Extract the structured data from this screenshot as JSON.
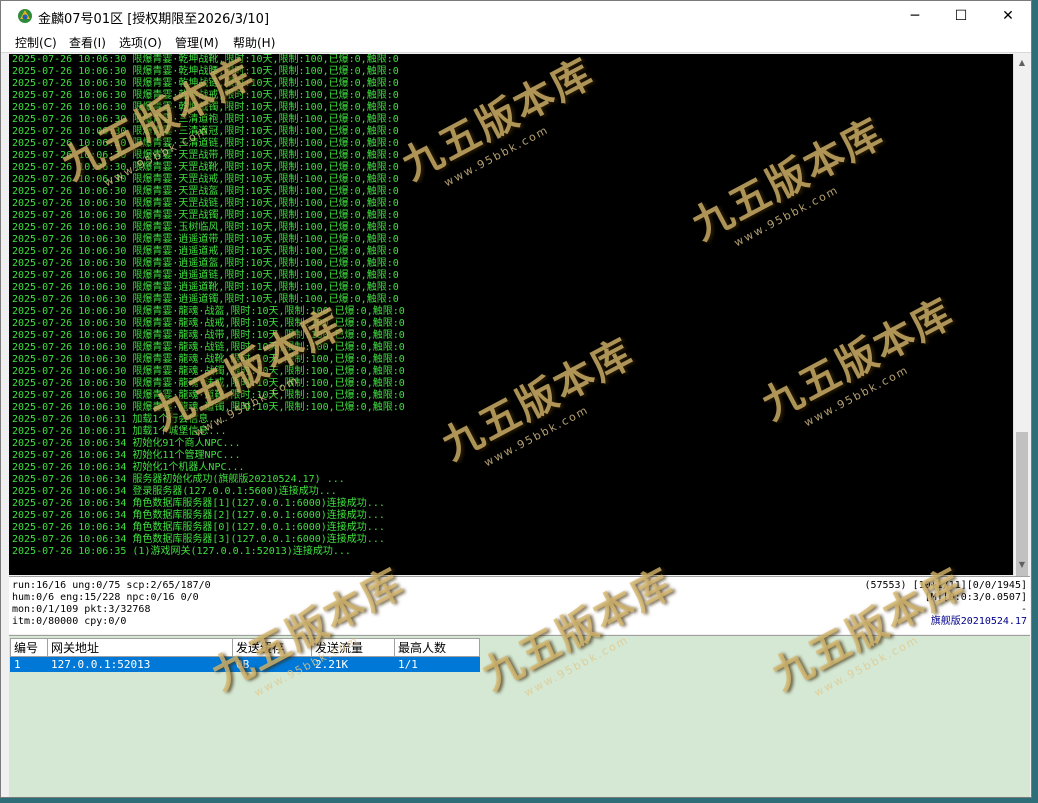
{
  "window": {
    "title": "金麟07号01区 [授权期限至2026/3/10]",
    "controls": {
      "minimize": "─",
      "maximize": "☐",
      "close": "✕"
    }
  },
  "menu": [
    {
      "label": "控制(C)"
    },
    {
      "label": "查看(I)"
    },
    {
      "label": "选项(O)"
    },
    {
      "label": "管理(M)"
    },
    {
      "label": "帮助(H)"
    }
  ],
  "console": {
    "lines": [
      "2025-07-26 10:06:30 限爆青霎·乾坤战靴,限时:10天,限制:100,已爆:0,触限:0",
      "2025-07-26 10:06:30 限爆青霎·乾坤战腰,限时:10天,限制:100,已爆:0,触限:0",
      "2025-07-26 10:06:30 限爆青霎·乾坤战链,限时:10天,限制:100,已爆:0,触限:0",
      "2025-07-26 10:06:30 限爆青霎·乾坤战戒,限时:10天,限制:100,已爆:0,触限:0",
      "2025-07-26 10:06:30 限爆青霎·乾坤战镯,限时:10天,限制:100,已爆:0,触限:0",
      "2025-07-26 10:06:30 限爆青霎·三清道袍,限时:10天,限制:100,已爆:0,触限:0",
      "2025-07-26 10:06:30 限爆青霎·三清道冠,限时:10天,限制:100,已爆:0,触限:0",
      "2025-07-26 10:06:30 限爆青霎·三清道链,限时:10天,限制:100,已爆:0,触限:0",
      "2025-07-26 10:06:30 限爆青霎·天罡战带,限时:10天,限制:100,已爆:0,触限:0",
      "2025-07-26 10:06:30 限爆青霎·天罡战靴,限时:10天,限制:100,已爆:0,触限:0",
      "2025-07-26 10:06:30 限爆青霎·天罡战戒,限时:10天,限制:100,已爆:0,触限:0",
      "2025-07-26 10:06:30 限爆青霎·天罡战盔,限时:10天,限制:100,已爆:0,触限:0",
      "2025-07-26 10:06:30 限爆青霎·天罡战链,限时:10天,限制:100,已爆:0,触限:0",
      "2025-07-26 10:06:30 限爆青霎·天罡战镯,限时:10天,限制:100,已爆:0,触限:0",
      "2025-07-26 10:06:30 限爆青霎·玉树临风,限时:10天,限制:100,已爆:0,触限:0",
      "2025-07-26 10:06:30 限爆青霎·逍遥道带,限时:10天,限制:100,已爆:0,触限:0",
      "2025-07-26 10:06:30 限爆青霎·逍遥道戒,限时:10天,限制:100,已爆:0,触限:0",
      "2025-07-26 10:06:30 限爆青霎·逍遥道盔,限时:10天,限制:100,已爆:0,触限:0",
      "2025-07-26 10:06:30 限爆青霎·逍遥道链,限时:10天,限制:100,已爆:0,触限:0",
      "2025-07-26 10:06:30 限爆青霎·逍遥道靴,限时:10天,限制:100,已爆:0,触限:0",
      "2025-07-26 10:06:30 限爆青霎·逍遥道镯,限时:10天,限制:100,已爆:0,触限:0",
      "2025-07-26 10:06:30 限爆青霎·龍魂·战盔,限时:10天,限制:100,已爆:0,触限:0",
      "2025-07-26 10:06:30 限爆青霎·龍魂·战戒,限时:10天,限制:100,已爆:0,触限:0",
      "2025-07-26 10:06:30 限爆青霎·龍魂·战带,限时:10天,限制:100,已爆:0,触限:0",
      "2025-07-26 10:06:30 限爆青霎·龍魂·战链,限时:10天,限制:100,已爆:0,触限:0",
      "2025-07-26 10:06:30 限爆青霎·龍魂·战靴,限时:10天,限制:100,已爆:0,触限:0",
      "2025-07-26 10:06:30 限爆青霎·龍魂·战镯,限时:10天,限制:100,已爆:0,触限:0",
      "2025-07-26 10:06:30 限爆青霎·龍魂·法戒,限时:10天,限制:100,已爆:0,触限:0",
      "2025-07-26 10:06:30 限爆青霎·龍魂·道靴,限时:10天,限制:100,已爆:0,触限:0",
      "2025-07-26 10:06:30 限爆青霎·龍魂·道镯,限时:10天,限制:100,已爆:0,触限:0",
      "2025-07-26 10:06:31 加载1个行会信息...",
      "2025-07-26 10:06:31 加载1个城堡信息...",
      "2025-07-26 10:06:34 初始化91个商人NPC...",
      "2025-07-26 10:06:34 初始化11个管理NPC...",
      "2025-07-26 10:06:34 初始化1个机器人NPC...",
      "2025-07-26 10:06:34 服务器初始化成功(旗舰版20210524.17) ...",
      "2025-07-26 10:06:34 登录服务器(127.0.0.1:5600)连接成功...",
      "2025-07-26 10:06:34 角色数据库服务器[1](127.0.0.1:6000)连接成功...",
      "2025-07-26 10:06:34 角色数据库服务器[2](127.0.0.1:6000)连接成功...",
      "2025-07-26 10:06:34 角色数据库服务器[0](127.0.0.1:6000)连接成功...",
      "2025-07-26 10:06:34 角色数据库服务器[3](127.0.0.1:6000)连接成功...",
      "2025-07-26 10:06:35 (1)游戏网关(127.0.0.1:52013)连接成功..."
    ]
  },
  "status": {
    "left": [
      "run:16/16 ung:0/75 scp:2/65/187/0",
      "hum:0/6 eng:15/228 npc:0/16 0/0",
      "mon:0/1/109 pkt:3/32768",
      "itm:0/80000 cpy:0/0"
    ],
    "right": [
      "(57553) [10+1/11][0/0/1945]",
      "[M][0:0:3/0.0507]",
      "-",
      "旗舰版20210524.17"
    ]
  },
  "gateway_table": {
    "headers": [
      "编号",
      "网关地址",
      "发送缓存",
      "发送流量",
      "最高人数"
    ],
    "rows": [
      [
        "1",
        "127.0.0.1:52013",
        "0B",
        "2.21K",
        "1/1"
      ]
    ]
  },
  "watermark": {
    "main": "九五版本库",
    "sub": "www.95bbk.com"
  }
}
